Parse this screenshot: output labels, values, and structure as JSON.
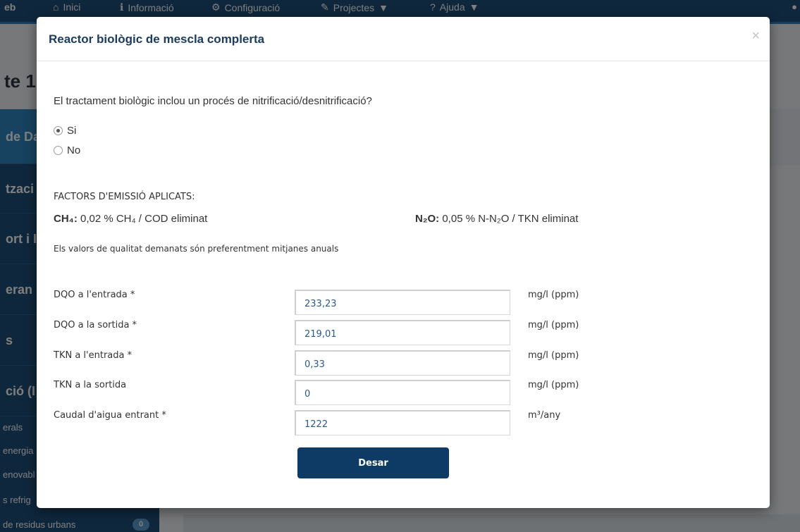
{
  "background": {
    "brand": "eb",
    "nav": [
      {
        "icon": "home-icon",
        "label": "Inici"
      },
      {
        "icon": "info-icon",
        "label": "Informació"
      },
      {
        "icon": "gears-icon",
        "label": "Configuració"
      },
      {
        "icon": "wrench-icon",
        "label": "Projectes"
      },
      {
        "icon": "question-icon",
        "label": "Ajuda"
      }
    ],
    "heading": "te 1",
    "sidebar": [
      "de Da",
      "tzaci",
      "ort i I",
      "eran",
      "s",
      "ció (I"
    ],
    "sidebar_sub": [
      "erals",
      "energia",
      "enovabl",
      "s refrig",
      " de residus urbans"
    ],
    "badge": "0"
  },
  "modal": {
    "title": "Reactor biològic de mescla complerta",
    "close": "×",
    "question": "El tractament biològic inclou un procés de nitrificació/desnitrificació?",
    "options": [
      {
        "label": "Si",
        "checked": true
      },
      {
        "label": "No",
        "checked": false
      }
    ],
    "factors_title": "FACTORS D'EMISSIÓ APLICATS:",
    "ch4": {
      "label": "CH₄:",
      "text": "0,02 % CH₄ / COD eliminat"
    },
    "n2o": {
      "label": "N₂O:",
      "text": "0,05 % N-N₂O / TKN eliminat"
    },
    "note": "Els valors de qualitat demanats són preferentment mitjanes anuals",
    "fields": [
      {
        "label": "DQO a l'entrada *",
        "value": "233,23",
        "unit": "mg/l (ppm)"
      },
      {
        "label": "DQO a la sortida *",
        "value": "219,01",
        "unit": "mg/l (ppm)"
      },
      {
        "label": "TKN a l'entrada *",
        "value": "0,33",
        "unit": "mg/l (ppm)"
      },
      {
        "label": "TKN a la sortida",
        "value": "0",
        "unit": "mg/l (ppm)"
      },
      {
        "label": "Caudal d'aigua entrant *",
        "value": "1222",
        "unit": "m³/any"
      }
    ],
    "save_label": "Desar"
  }
}
